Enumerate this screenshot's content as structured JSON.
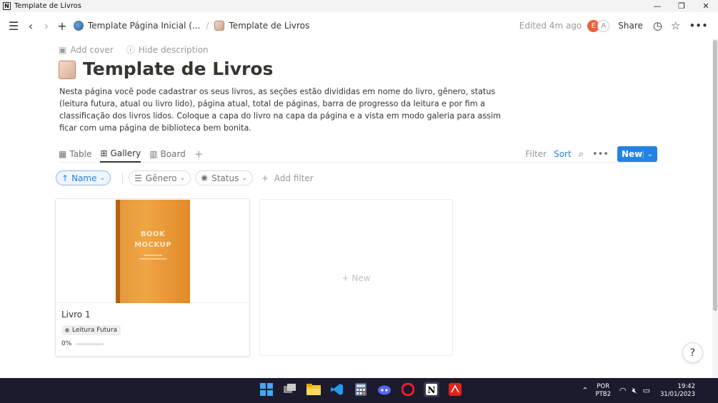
{
  "window": {
    "title": "Template de Livros",
    "controls": [
      "—",
      "❐",
      "✕"
    ]
  },
  "nav": {
    "breadcrumb_1": "Template Página Inicial (...",
    "breadcrumb_sep": "/",
    "breadcrumb_2": "Template de Livros",
    "edited": "Edited 4m ago",
    "avatar_1": "E",
    "avatar_2": "A",
    "share": "Share"
  },
  "page": {
    "add_cover": "Add cover",
    "hide_description": "Hide description",
    "title": "Template de Livros",
    "description": "Nesta página você pode cadastrar os seus livros, as seções estão divididas em nome do livro, gênero, status (leitura futura, atual ou livro lido), página atual, total de páginas, barra de progresso da leitura e por fim a classificação dos livros lidos. Coloque a capa do livro na capa da página e a vista em modo galeria para assim ficar com uma página de biblioteca bem bonita."
  },
  "views": {
    "tabs": [
      {
        "label": "Table",
        "icon": "table-icon"
      },
      {
        "label": "Gallery",
        "icon": "gallery-icon"
      },
      {
        "label": "Board",
        "icon": "board-icon"
      }
    ],
    "active": "Gallery",
    "filter": "Filter",
    "sort": "Sort",
    "new": "New"
  },
  "filters": {
    "name": "Name",
    "genero": "Gênero",
    "status": "Status",
    "add_filter": "Add filter"
  },
  "gallery": {
    "cards": [
      {
        "title": "Livro 1",
        "cover_line1": "BOOK",
        "cover_line2": "MOCKUP",
        "status": "Leitura Futura",
        "progress_text": "0%",
        "progress": 0
      }
    ],
    "new_label": "+ New"
  },
  "help": "?",
  "taskbar": {
    "lang_1": "POR",
    "lang_2": "PTB2",
    "time": "19:42",
    "date": "31/01/2023"
  },
  "colors": {
    "accent": "#2383e2",
    "avatar": "#e8623a",
    "book_cover": "#f0a544"
  }
}
